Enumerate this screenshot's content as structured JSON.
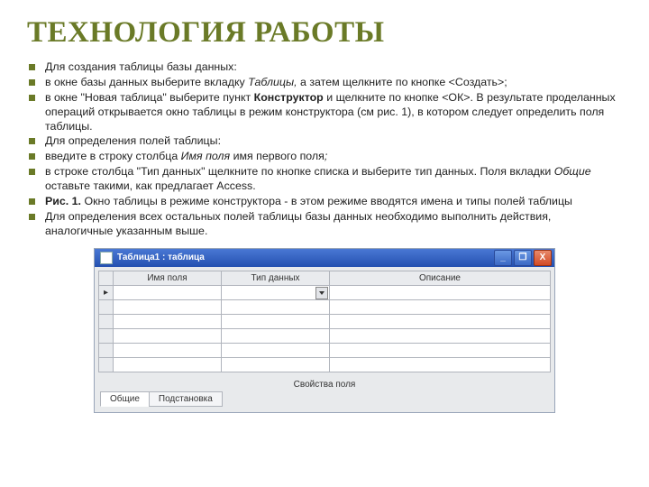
{
  "title": "ТЕХНОЛОГИЯ РАБОТЫ",
  "bullets": [
    {
      "parts": [
        {
          "t": "Для создания таблицы базы данных:"
        }
      ]
    },
    {
      "parts": [
        {
          "t": "в окне базы данных выберите вкладку "
        },
        {
          "t": "Таблицы,",
          "cls": "i"
        },
        {
          "t": "  а затем щелкните по кнопке <Создать>;"
        }
      ]
    },
    {
      "parts": [
        {
          "t": "в окне \"Новая таблица\" выберите пункт "
        },
        {
          "t": "Конструктор",
          "cls": "b"
        },
        {
          "t": " и щелкните по кнопке <ОК>. В результате проделанных операций открывается окно таблицы в режим конструктора (см рис. 1), в котором следует определить поля таблицы."
        }
      ]
    },
    {
      "parts": [
        {
          "t": "Для определения полей таблицы:"
        }
      ]
    },
    {
      "parts": [
        {
          "t": "введите в строку столбца "
        },
        {
          "t": "Имя поля",
          "cls": "i"
        },
        {
          "t": " имя первого поля"
        },
        {
          "t": ";",
          "cls": "i"
        }
      ]
    },
    {
      "parts": [
        {
          "t": "в строке столбца \"Тип данных\" щелкните по кнопке списка и выберите тип данных. Поля вкладки "
        },
        {
          "t": "Общие",
          "cls": "i"
        },
        {
          "t": " оставьте такими, как предлагает Access."
        }
      ]
    },
    {
      "parts": [
        {
          "t": "Рис. 1.",
          "cls": "b"
        },
        {
          "t": " Окно таблицы в режиме конструктора - в этом режиме вводятся имена и типы полей таблицы"
        }
      ]
    },
    {
      "parts": [
        {
          "t": "Для определения всех остальных полей таблицы базы данных необходимо выполнить действия, аналогичные указанным выше."
        }
      ]
    }
  ],
  "window": {
    "title": "Таблица1 : таблица",
    "minimize": "_",
    "restore": "❐",
    "close": "X",
    "columns": [
      "Имя поля",
      "Тип данных",
      "Описание"
    ],
    "current_marker": "▸",
    "props_label": "Свойства поля",
    "tabs": [
      "Общие",
      "Подстановка"
    ]
  }
}
